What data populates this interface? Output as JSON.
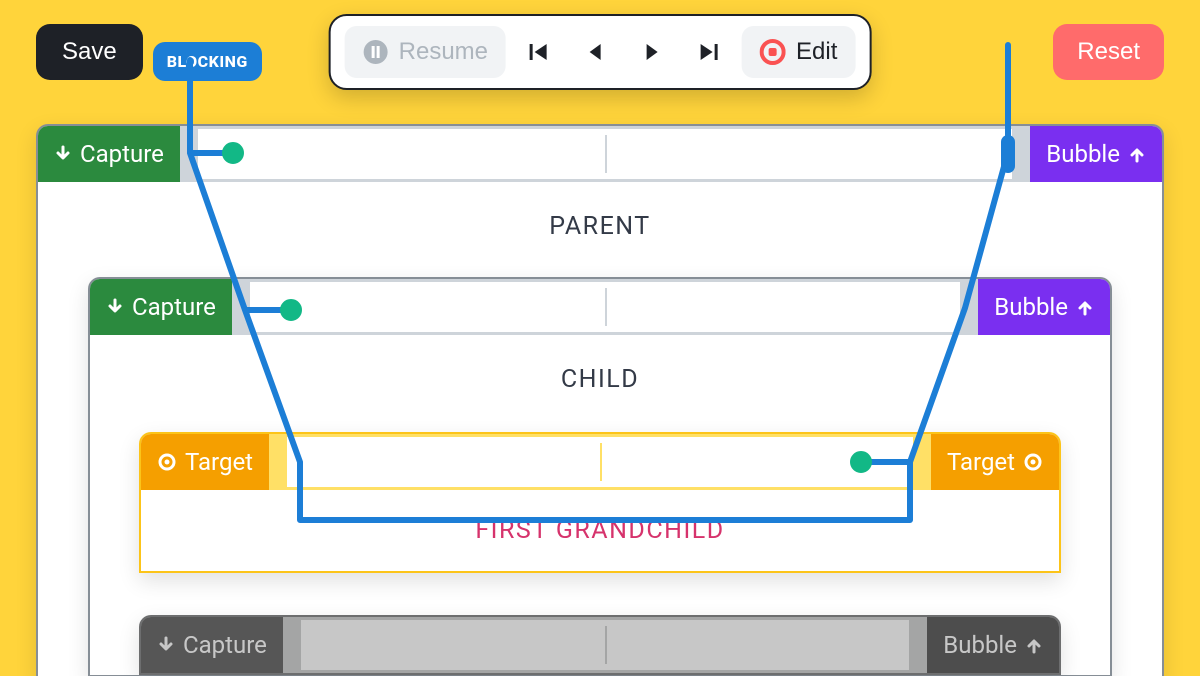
{
  "toolbar": {
    "save": "Save",
    "blocking": "BLOCKING",
    "resume": "Resume",
    "edit": "Edit",
    "reset": "Reset"
  },
  "labels": {
    "capture": "Capture",
    "bubble": "Bubble",
    "target": "Target"
  },
  "nodes": {
    "parent": "PARENT",
    "child": "CHILD",
    "grandchild1": "FIRST GRANDCHILD"
  },
  "colors": {
    "bg": "#ffd43b",
    "capture": "#2b8a3e",
    "bubble": "#7a2ff0",
    "target": "#f59f00",
    "path": "#1c7ed6",
    "dot": "#12b886",
    "reset": "#ff6b6b",
    "grandchild_highlight": "#d6336c"
  }
}
